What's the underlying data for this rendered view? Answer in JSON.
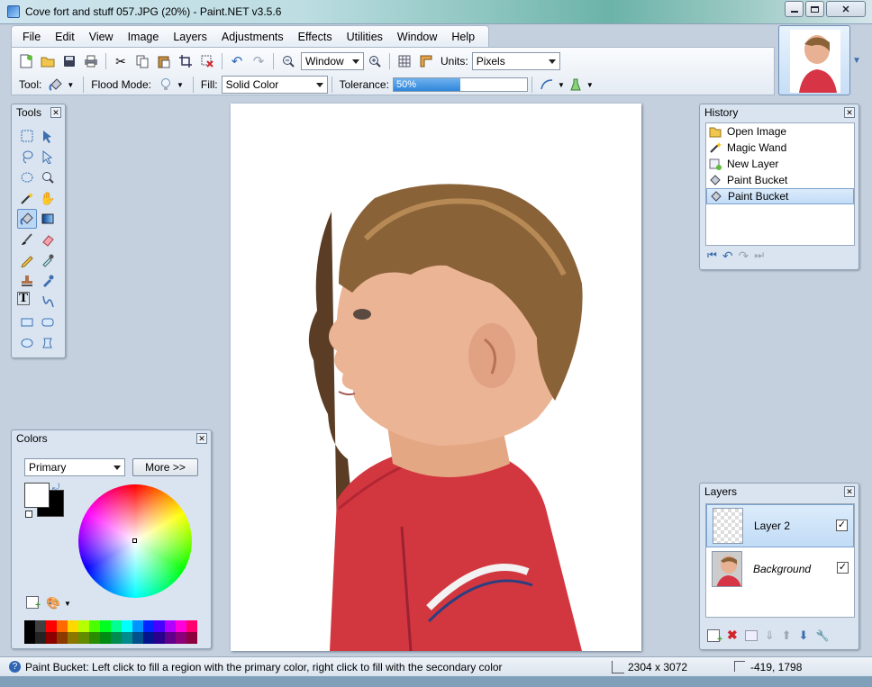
{
  "window": {
    "title": "Cove fort and stuff 057.JPG (20%) - Paint.NET v3.5.6"
  },
  "menu": [
    "File",
    "Edit",
    "View",
    "Image",
    "Layers",
    "Adjustments",
    "Effects",
    "Utilities",
    "Window",
    "Help"
  ],
  "toolbar": {
    "zoom_value": "Window",
    "units_label": "Units:",
    "units_value": "Pixels",
    "tool_label": "Tool:",
    "flood_mode_label": "Flood Mode:",
    "fill_label": "Fill:",
    "fill_value": "Solid Color",
    "tolerance_label": "Tolerance:",
    "tolerance_value": "50%",
    "tolerance_fraction": 0.5
  },
  "tools_panel": {
    "title": "Tools"
  },
  "history_panel": {
    "title": "History",
    "items": [
      "Open Image",
      "Magic Wand",
      "New Layer",
      "Paint Bucket",
      "Paint Bucket"
    ],
    "selected_index": 4
  },
  "colors_panel": {
    "title": "Colors",
    "mode_value": "Primary",
    "more_label": "More >>",
    "primary_color": "#ffffff",
    "secondary_color": "#000000"
  },
  "layers_panel": {
    "title": "Layers",
    "layers": [
      {
        "name": "Layer 2",
        "visible": true,
        "selected": true
      },
      {
        "name": "Background",
        "visible": true,
        "selected": false
      }
    ]
  },
  "status": {
    "message": "Paint Bucket: Left click to fill a region with the primary color, right click to fill with the secondary color",
    "image_size": "2304 x 3072",
    "cursor_position": "-419, 1798"
  },
  "palette": [
    "#000000",
    "#404040",
    "#ff0000",
    "#ff6a00",
    "#ffd800",
    "#b6ff00",
    "#4cff00",
    "#00ff21",
    "#00ff90",
    "#00ffff",
    "#0094ff",
    "#0026ff",
    "#4800ff",
    "#b200ff",
    "#ff00dc",
    "#ff006e"
  ]
}
